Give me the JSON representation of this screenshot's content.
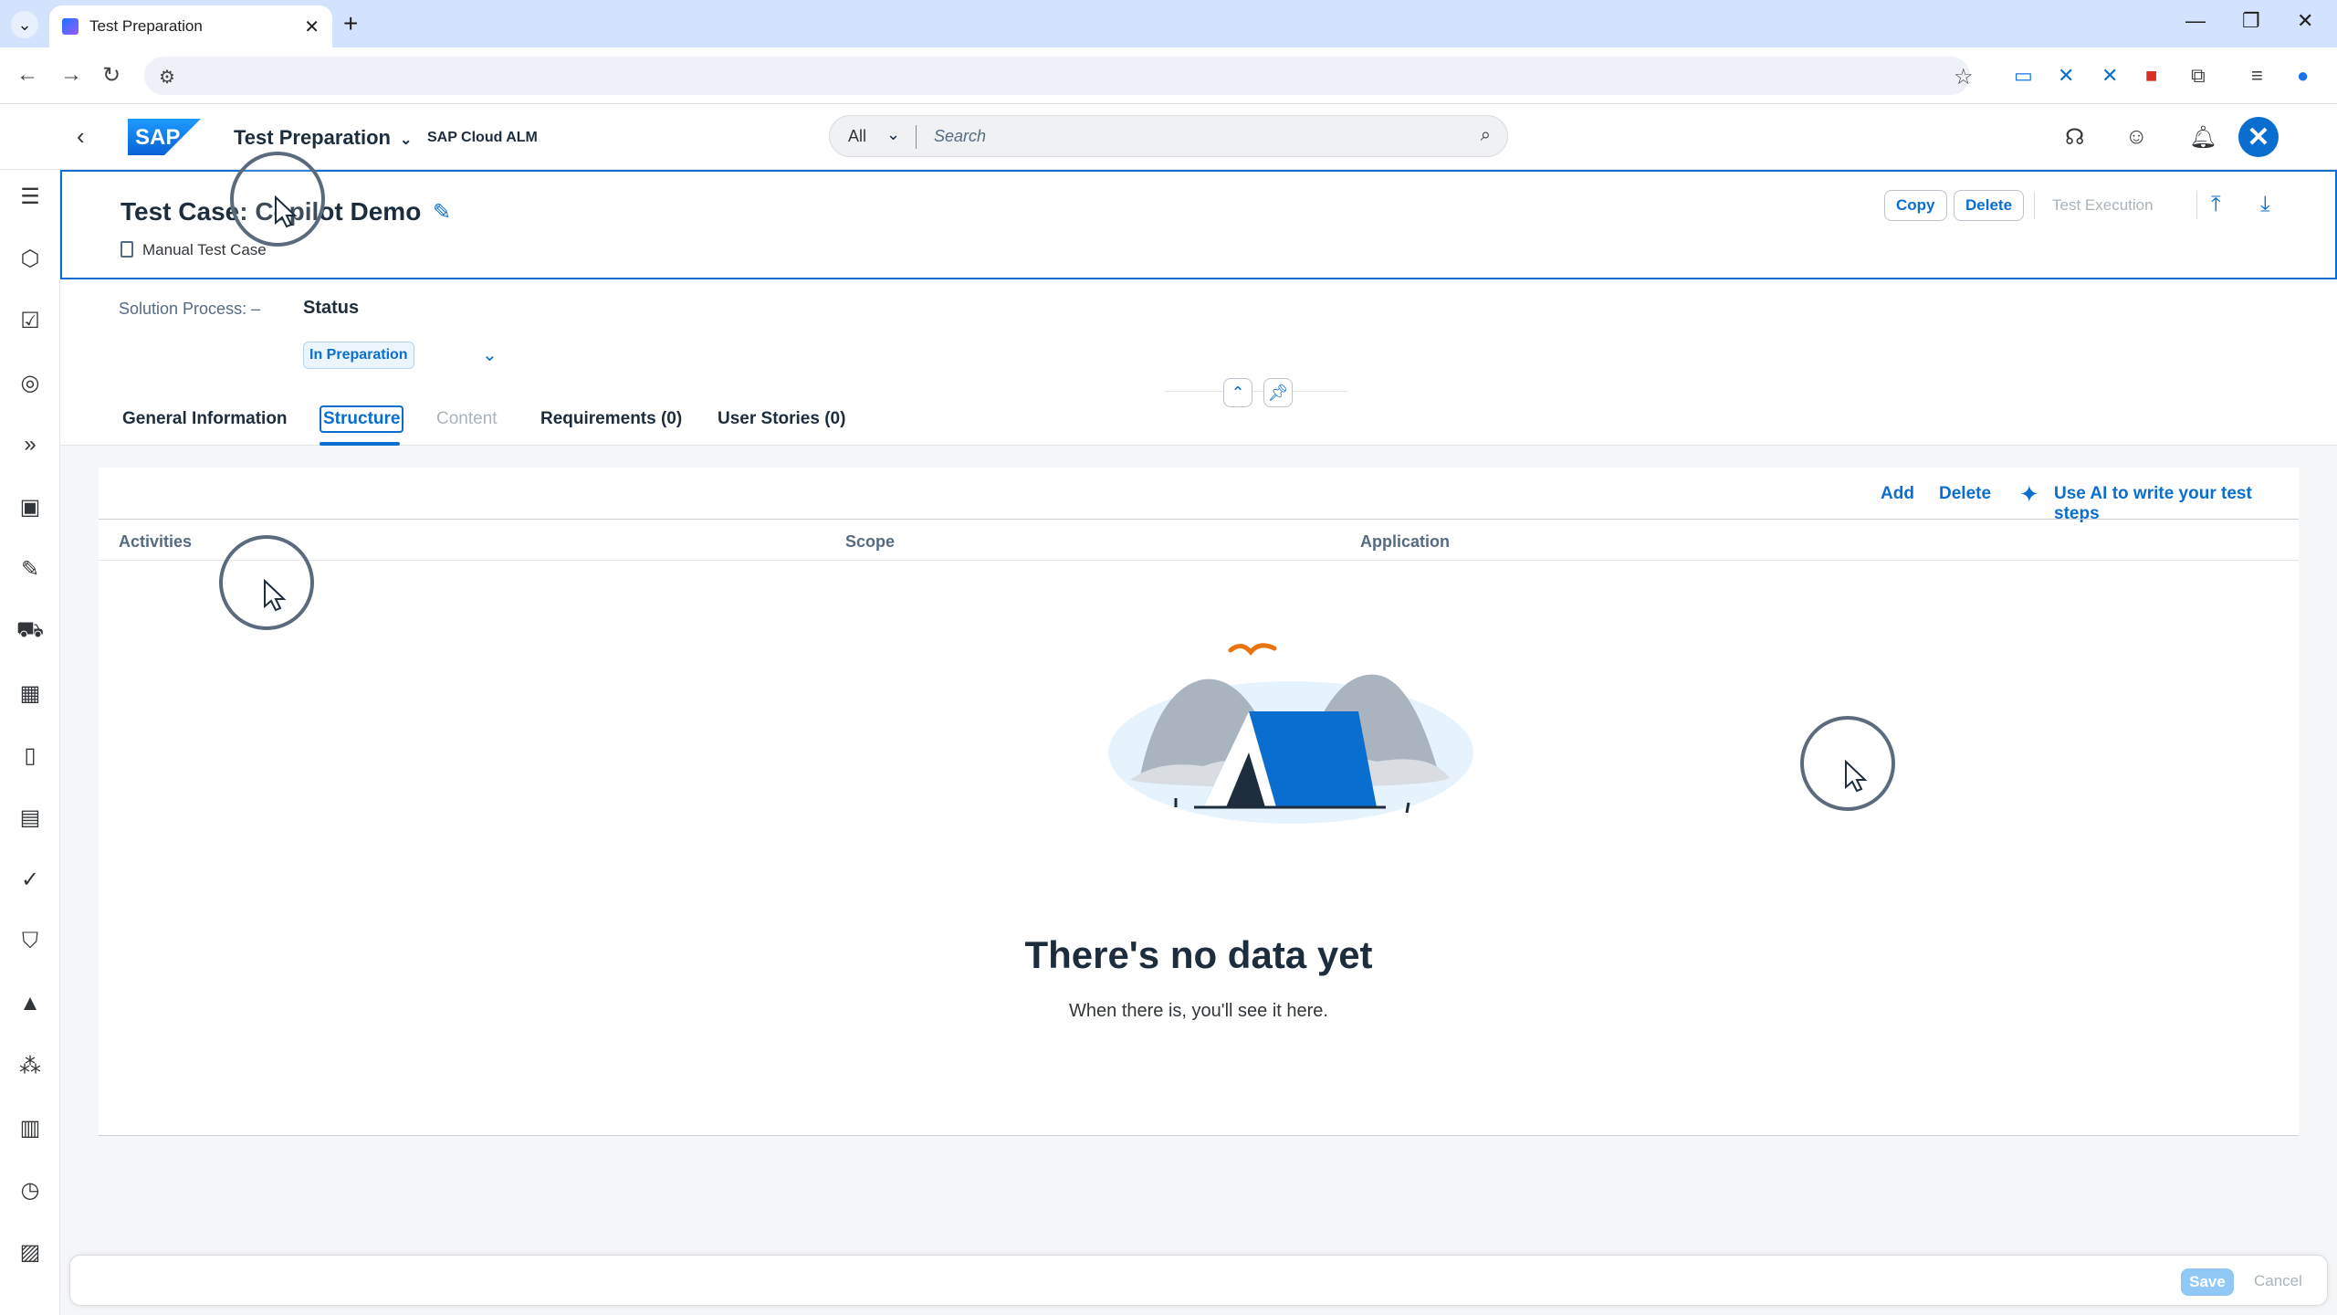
{
  "browser": {
    "tab_title": "Test Preparation",
    "tab_list_icon": "chevron-down-icon",
    "new_tab_symbol": "+"
  },
  "shell": {
    "app_title": "Test Preparation",
    "product_name": "SAP Cloud ALM",
    "logo_text": "SAP",
    "search_scope": "All",
    "search_placeholder": "Search"
  },
  "header": {
    "title": "Test Case: Copilot Demo",
    "subtitle": "Manual Test Case",
    "actions": {
      "copy": "Copy",
      "delete": "Delete",
      "test_execution": "Test Execution"
    }
  },
  "details": {
    "solution_process_label": "Solution Process: –",
    "status_label": "Status",
    "status_value": "In Preparation"
  },
  "tabs": [
    {
      "label": "General Information",
      "state": "normal"
    },
    {
      "label": "Structure",
      "state": "selected"
    },
    {
      "label": "Content",
      "state": "disabled"
    },
    {
      "label": "Requirements (0)",
      "state": "normal"
    },
    {
      "label": "User Stories (0)",
      "state": "normal"
    }
  ],
  "table": {
    "toolbar": {
      "add": "Add",
      "delete": "Delete",
      "ai": "Use AI to write your test steps"
    },
    "columns": [
      "Activities",
      "Scope",
      "Application"
    ],
    "empty_title": "There's no data yet",
    "empty_subtitle": "When there is, you'll see it here."
  },
  "footer": {
    "save": "Save",
    "cancel": "Cancel"
  },
  "colors": {
    "accent": "#0a6ed1",
    "shell_bg": "#ffffff",
    "page_bg": "#f5f6f7",
    "browser_tabbar": "#d3e3fd"
  }
}
